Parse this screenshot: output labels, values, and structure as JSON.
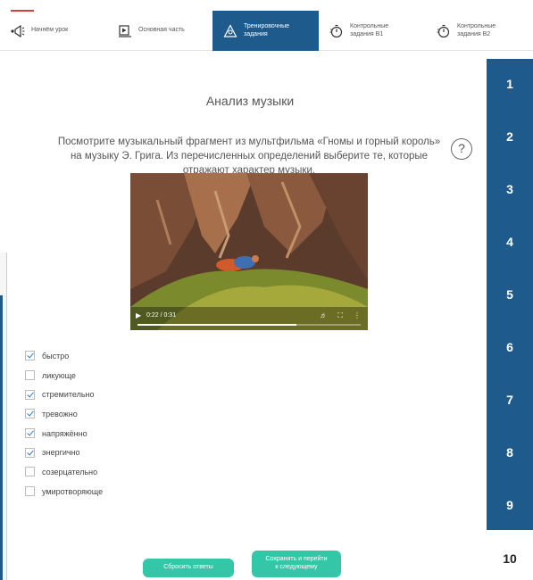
{
  "nav": {
    "tabs": [
      {
        "label": "Начнём урок",
        "icon": "horn-icon",
        "active": false
      },
      {
        "label": "Основная часть",
        "icon": "play-board-icon",
        "active": false
      },
      {
        "label": "Тренировочные задания",
        "icon": "triangle-bulb-icon",
        "active": true
      },
      {
        "label": "Контрольные задания В1",
        "icon": "stopwatch-icon",
        "active": false
      },
      {
        "label": "Контрольные задания В2",
        "icon": "stopwatch-icon",
        "active": false
      }
    ]
  },
  "page": {
    "title": "Анализ музыки",
    "prompt": "Посмотрите музыкальный фрагмент из мультфильма «Гномы и горный король» на музыку Э. Грига. Из перечисленных определений выберите те, которые отражают характер музыки.",
    "help_symbol": "?"
  },
  "video": {
    "time": "0:22 / 0:31",
    "progress": 0.71
  },
  "options": [
    {
      "label": "быстро",
      "checked": true
    },
    {
      "label": "ликующе",
      "checked": false
    },
    {
      "label": "стремительно",
      "checked": true
    },
    {
      "label": "тревожно",
      "checked": true
    },
    {
      "label": "напряжённо",
      "checked": true
    },
    {
      "label": "энергично",
      "checked": true
    },
    {
      "label": "созерцательно",
      "checked": false
    },
    {
      "label": "умиротворяюще",
      "checked": false
    }
  ],
  "sidebar": {
    "numbers": [
      "1",
      "2",
      "3",
      "4",
      "5",
      "6",
      "7",
      "8",
      "9",
      "10"
    ],
    "active": "10"
  },
  "buttons": {
    "reset": "Сбросить ответы",
    "save_line1": "Сохранить и перейти",
    "save_line2": "к следующему"
  },
  "colors": {
    "primary": "#1e5a8c",
    "accent_button": "#33c7a8",
    "check": "#2b7bd0"
  }
}
